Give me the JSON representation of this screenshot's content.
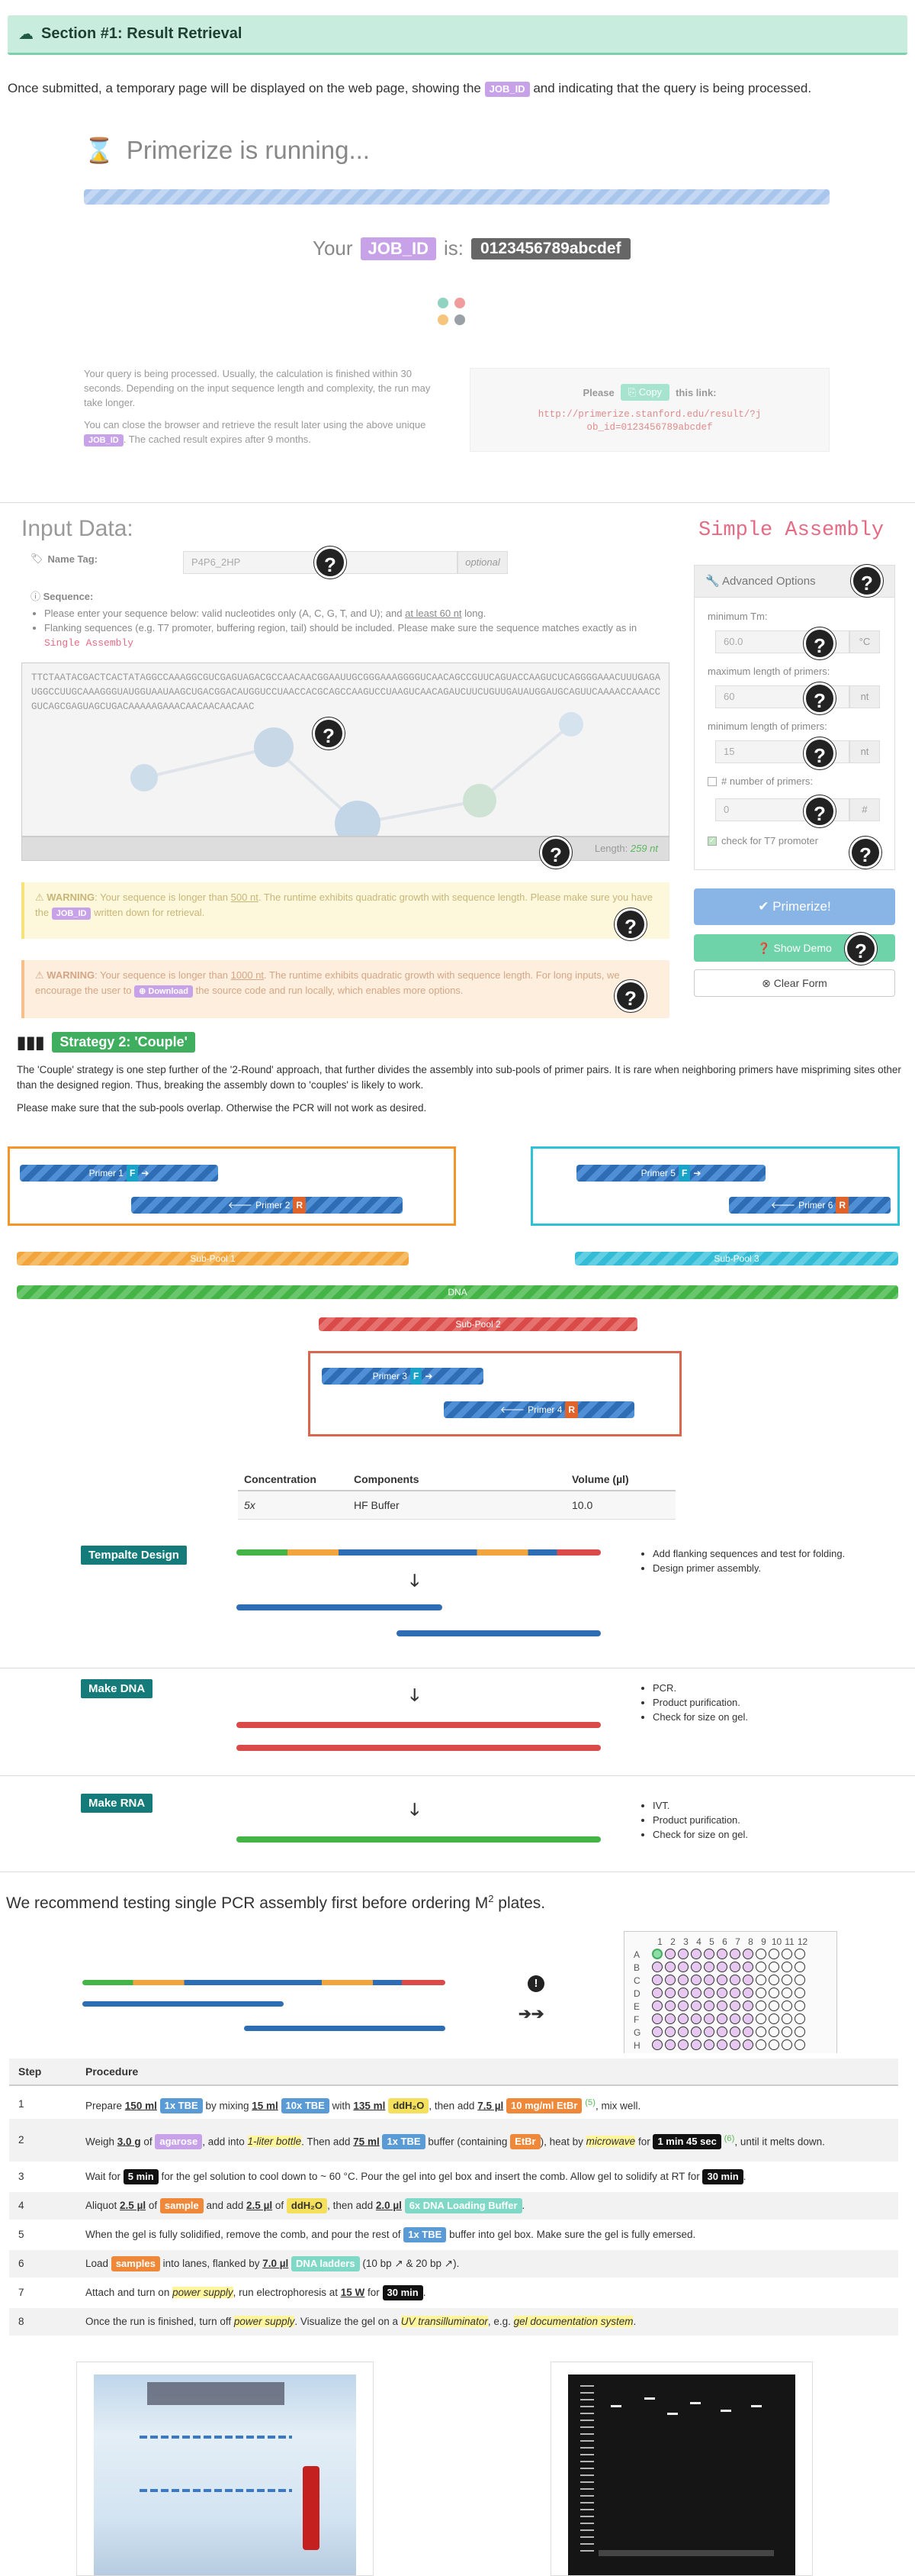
{
  "section_title": "Section #1: Result Retrieval",
  "intro": {
    "before": "Once submitted, a temporary page will be displayed on the web page, showing the",
    "tag": "JOB_ID",
    "after": "and indicating that the query is being processed."
  },
  "running": {
    "title": "Primerize is running...",
    "your": "Your",
    "job_tag": "JOB_ID",
    "is": "is:",
    "job_id": "0123456789abcdef",
    "info1": "Your query is being processed. Usually, the calculation is finished within 30 seconds. Depending on the input sequence length and complexity, the run may take longer.",
    "info2_a": "You can close the browser and retrieve the result later using the above unique",
    "info2_tag": "JOB_ID",
    "info2_b": ". The cached result expires after 9 months.",
    "please": "Please",
    "copy": "Copy",
    "this_link": "this link:",
    "link": "http://primerize.stanford.edu/result/?job_id=0123456789abcdef"
  },
  "input": {
    "title": "Input Data:",
    "simple": "Simple Assembly",
    "name_tag_label": "Name Tag:",
    "name_tag_value": "P4P6_2HP",
    "optional": "optional",
    "sequence_label": "Sequence:",
    "bullet1_a": "Please enter your sequence below: valid nucleotides only (A, C, G, T, and U); and",
    "bullet1_b": "at least 60 nt",
    "bullet1_c": "long.",
    "bullet2_a": "Flanking sequences (e.g. T7 promoter, buffering region, tail) should be included. Please make sure the sequence matches exactly as in",
    "bullet2_b": "Single Assembly",
    "sequence": "TTCTAATACGACTCACTATAGGCCAAAGGCGUCGAGUAGACGCCAACAACGGAAUUGCGGGAAAGGGGUCAACAGCCGUUCAGUACCAAGUCUCAGGGGAAACUUUGAGAUGGCCUUGCAAAGGGUAUGGUAAUAAGCUGACGGACAUGGUCCUAACCACGCAGCCAAGUCCUAAGUCAACAGAUCUUCUGUUGAUAUGGAUGCAGUUCAAAACCAAACCGUCAGCGAGUAGCUGACAAAAAGAAACAACAACAACAAC",
    "length_label": "Length:",
    "length_value": "259 nt",
    "warn1_a": "WARNING",
    "warn1_b": ": Your sequence is longer than",
    "warn1_c": "500 nt",
    "warn1_d": ". The runtime exhibits quadratic growth with sequence length. Please make sure you have the",
    "warn1_tag": "JOB_ID",
    "warn1_e": "written down for retrieval.",
    "warn2_a": "WARNING",
    "warn2_b": ": Your sequence is longer than",
    "warn2_c": "1000 nt",
    "warn2_d": ". The runtime exhibits quadratic growth with sequence length. For long inputs, we encourage the user to",
    "warn2_tag": "Download",
    "warn2_e": "the source code and run locally, which enables more options.",
    "adv_title": "Advanced Options",
    "min_tm_label": "minimum Tm:",
    "min_tm": "60.0",
    "min_tm_unit": "°C",
    "max_len_label": "maximum length of primers:",
    "max_len": "60",
    "min_len_label": "minimum length of primers:",
    "min_len": "15",
    "num_label": "# number of primers:",
    "num": "0",
    "nt": "nt",
    "hash": "#",
    "t7_label": "check for T7 promoter",
    "primerize_btn": "Primerize!",
    "demo_btn": "Show Demo",
    "clear_btn": "Clear Form"
  },
  "strategy": {
    "title": "Strategy 2: 'Couple'",
    "p1": "The 'Couple' strategy is one step further of the '2-Round' approach, that further divides the assembly into sub-pools of primer pairs. It is rare when neighboring primers have mispriming sites other than the designed region. Thus, breaking the assembly down to 'couples' is likely to work.",
    "p2": "Please make sure that the sub-pools overlap. Otherwise the PCR will not work as desired.",
    "primer1": "Primer 1",
    "primer2": "Primer 2",
    "primer3": "Primer 3",
    "primer4": "Primer 4",
    "primer5": "Primer 5",
    "primer6": "Primer 6",
    "f": "F",
    "r": "R",
    "subpool1": "Sub-Pool 1",
    "subpool2": "Sub-Pool 2",
    "subpool3": "Sub-Pool 3",
    "dna": "DNA"
  },
  "conc_table": {
    "headers": [
      "Concentration",
      "Components",
      "Volume (µl)"
    ],
    "row": [
      "5x",
      "HF Buffer",
      "10.0"
    ]
  },
  "workflow": {
    "design_label": "Tempalte Design",
    "design_items": [
      "Add flanking sequences and test for folding.",
      "Design primer assembly."
    ],
    "dna_label": "Make DNA",
    "dna_items": [
      "PCR.",
      "Product purification.",
      "Check for size on gel."
    ],
    "rna_label": "Make RNA",
    "rna_items": [
      "IVT.",
      "Product purification.",
      "Check for size on gel."
    ]
  },
  "recommend": {
    "text_a": "We recommend testing single PCR assembly first before ordering M",
    "sup": "2",
    "text_b": " plates.",
    "plate_cols": [
      "1",
      "2",
      "3",
      "4",
      "5",
      "6",
      "7",
      "8",
      "9",
      "10",
      "11",
      "12"
    ],
    "plate_rows": [
      "A",
      "B",
      "C",
      "D",
      "E",
      "F",
      "G",
      "H"
    ]
  },
  "protocol": {
    "headers": [
      "Step",
      "Procedure"
    ],
    "steps": [
      {
        "n": "1"
      },
      {
        "n": "2"
      },
      {
        "n": "3"
      },
      {
        "n": "4"
      },
      {
        "n": "5"
      },
      {
        "n": "6"
      },
      {
        "n": "7"
      },
      {
        "n": "8"
      }
    ],
    "s1": [
      "Prepare",
      "150 ml",
      "1x TBE",
      "by mixing",
      "15 ml",
      "10x TBE",
      "with",
      "135 ml",
      "ddH₂O",
      ", then add",
      "7.5 µl",
      "10 mg/ml EtBr",
      "(5)",
      ", mix well."
    ],
    "s2": [
      "Weigh",
      "3.0 g",
      "of",
      "agarose",
      ", add into",
      "1-liter bottle",
      ". Then add",
      "75 ml",
      "1x TBE",
      "buffer (containing",
      "EtBr",
      "), heat by",
      "microwave",
      "for",
      "1 min 45 sec",
      "(6)",
      ", until it melts down."
    ],
    "s3": [
      "Wait for",
      "5 min",
      "for the gel solution to cool down to ~ 60 °C. Pour the gel into gel box and insert the comb. Allow gel to solidify at RT for",
      "30 min",
      "."
    ],
    "s4": [
      "Aliquot",
      "2.5 µl",
      "of",
      "sample",
      "and add",
      "2.5 µl",
      "of",
      "ddH₂O",
      ", then add",
      "2.0 µl",
      "6x DNA Loading Buffer",
      "."
    ],
    "s5": [
      "When the gel is fully solidified, remove the comb, and pour the rest of",
      "1x TBE",
      "buffer into gel box. Make sure the gel is fully emersed."
    ],
    "s6": [
      "Load",
      "samples",
      "into lanes, flanked by",
      "7.0 µl",
      "DNA ladders",
      "(10 bp",
      "& 20 bp",
      ")."
    ],
    "s7": [
      "Attach and turn on",
      "power supply",
      ", run electrophoresis at",
      "15 W",
      "for",
      "30 min",
      "."
    ],
    "s8": [
      "Once the run is finished, turn off",
      "power supply",
      ". Visualize the gel on a",
      "UV transilluminator",
      ", e.g.",
      "gel documentation system",
      "."
    ]
  },
  "colors": {
    "accent": "#5cb85c",
    "teal": "#157a7a",
    "header_bg": "#c8ecdd",
    "purple": "#c8a2e8"
  }
}
